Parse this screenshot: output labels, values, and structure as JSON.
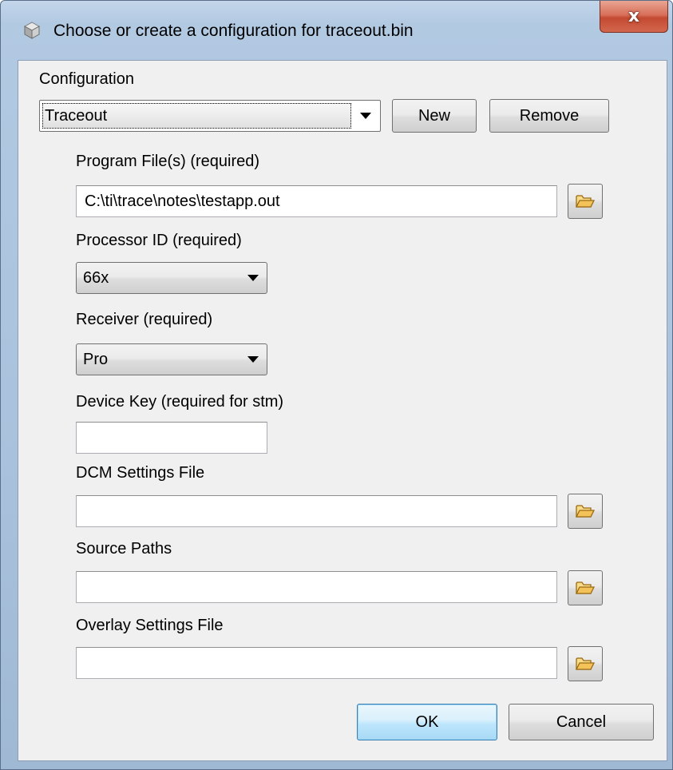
{
  "window": {
    "title": "Choose or create a configuration for traceout.bin",
    "close_glyph": "x"
  },
  "configuration": {
    "label": "Configuration",
    "selected": "Traceout",
    "new_label": "New",
    "remove_label": "Remove"
  },
  "program_files": {
    "label": "Program File(s) (required)",
    "value": "C:\\ti\\trace\\notes\\testapp.out"
  },
  "processor_id": {
    "label": "Processor ID (required)",
    "selected": "66x"
  },
  "receiver": {
    "label": "Receiver (required)",
    "selected": "Pro"
  },
  "device_key": {
    "label": "Device Key (required for stm)",
    "value": ""
  },
  "dcm_settings": {
    "label": "DCM Settings File",
    "value": ""
  },
  "source_paths": {
    "label": "Source Paths",
    "value": ""
  },
  "overlay_settings": {
    "label": "Overlay Settings File",
    "value": ""
  },
  "buttons": {
    "ok_label": "OK",
    "cancel_label": "Cancel"
  },
  "icons": {
    "app": "eclipse-cube-icon",
    "browse": "open-folder-icon",
    "folder_color": "#f3c35a"
  }
}
